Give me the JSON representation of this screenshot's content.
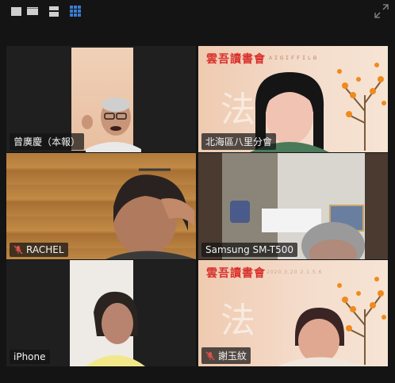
{
  "toolbar": {
    "buttons": [
      {
        "name": "speaker-view-button",
        "icon": "speaker-view-icon"
      },
      {
        "name": "thumbnail-view-button",
        "icon": "thumbnail-view-icon"
      },
      {
        "name": "stacked-view-button",
        "icon": "stacked-view-icon"
      },
      {
        "name": "gallery-view-button",
        "icon": "gallery-view-icon",
        "active": true
      }
    ],
    "fullscreen_icon": "fullscreen-exit-icon"
  },
  "colors": {
    "active_speaker": "#2fd37a",
    "mute": "#e05050",
    "brand": "#d9302c",
    "view_active": "#3a7bd5"
  },
  "participants": [
    {
      "name": "曾廣慶（本報）",
      "muted": false,
      "active": true
    },
    {
      "name": "北海區八里分會",
      "muted": false,
      "active": false,
      "banner": {
        "title": "雲吾讀書會",
        "subtitle": "ＡＩＧＩＦＦＩＬＢ",
        "glyph": "法"
      }
    },
    {
      "name": "RACHEL",
      "muted": true,
      "active": false
    },
    {
      "name": "Samsung SM-T500",
      "muted": false,
      "active": false
    },
    {
      "name": "iPhone",
      "muted": false,
      "active": false
    },
    {
      "name": "謝玉紋",
      "muted": true,
      "active": false,
      "banner": {
        "title": "雲吾讀書會",
        "subtitle": "2020.3.20 2.1.5.6",
        "glyph": "法"
      }
    }
  ]
}
